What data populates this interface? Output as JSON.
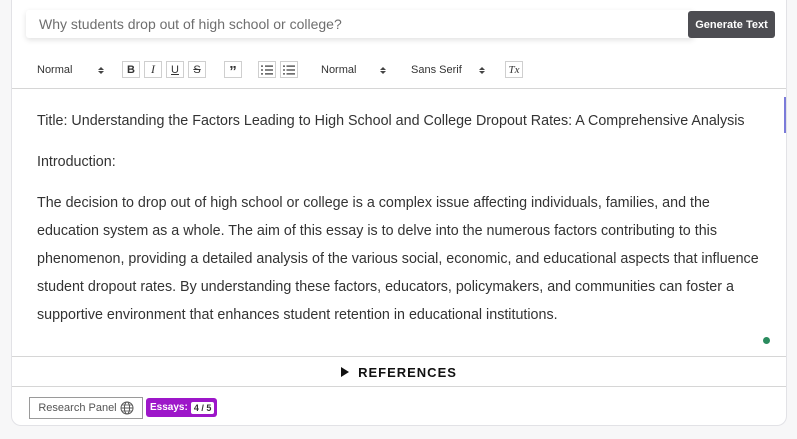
{
  "prompt": {
    "placeholder": "Why students drop out of high school or college?"
  },
  "generate_button": {
    "label": "Generate Text"
  },
  "toolbar": {
    "heading_select": "Normal",
    "bold": "B",
    "italic": "I",
    "underline": "U",
    "strike": "S",
    "quote": "”",
    "size_select": "Normal",
    "font_select": "Sans Serif",
    "clear_format": "Tx"
  },
  "editor": {
    "title": "Title: Understanding the Factors Leading to High School and College Dropout Rates: A Comprehensive Analysis",
    "intro_heading": "Introduction:",
    "body": "The decision to drop out of high school or college is a complex issue affecting individuals, families, and the education system as a whole. The aim of this essay is to delve into the numerous factors contributing to this phenomenon, providing a detailed analysis of the various social, economic, and educational aspects that influence student dropout rates. By understanding these factors, educators, policymakers, and communities can foster a supportive environment that enhances student retention in educational institutions."
  },
  "references": {
    "label": "REFERENCES"
  },
  "footer": {
    "research_panel_label": "Research Panel",
    "essays_label": "Essays:",
    "essays_count": "4 / 5"
  },
  "colors": {
    "generate_button_bg": "#4d4d52",
    "essays_badge_bg": "#9d17c9",
    "status_dot": "#2a8b5e",
    "editor_focus_bar": "#7b7bd9"
  },
  "icons": {
    "research_panel": "globe-icon",
    "references": "triangle-right-icon",
    "list_ordered": "ordered-list-icon",
    "list_bullet": "bullet-list-icon"
  }
}
